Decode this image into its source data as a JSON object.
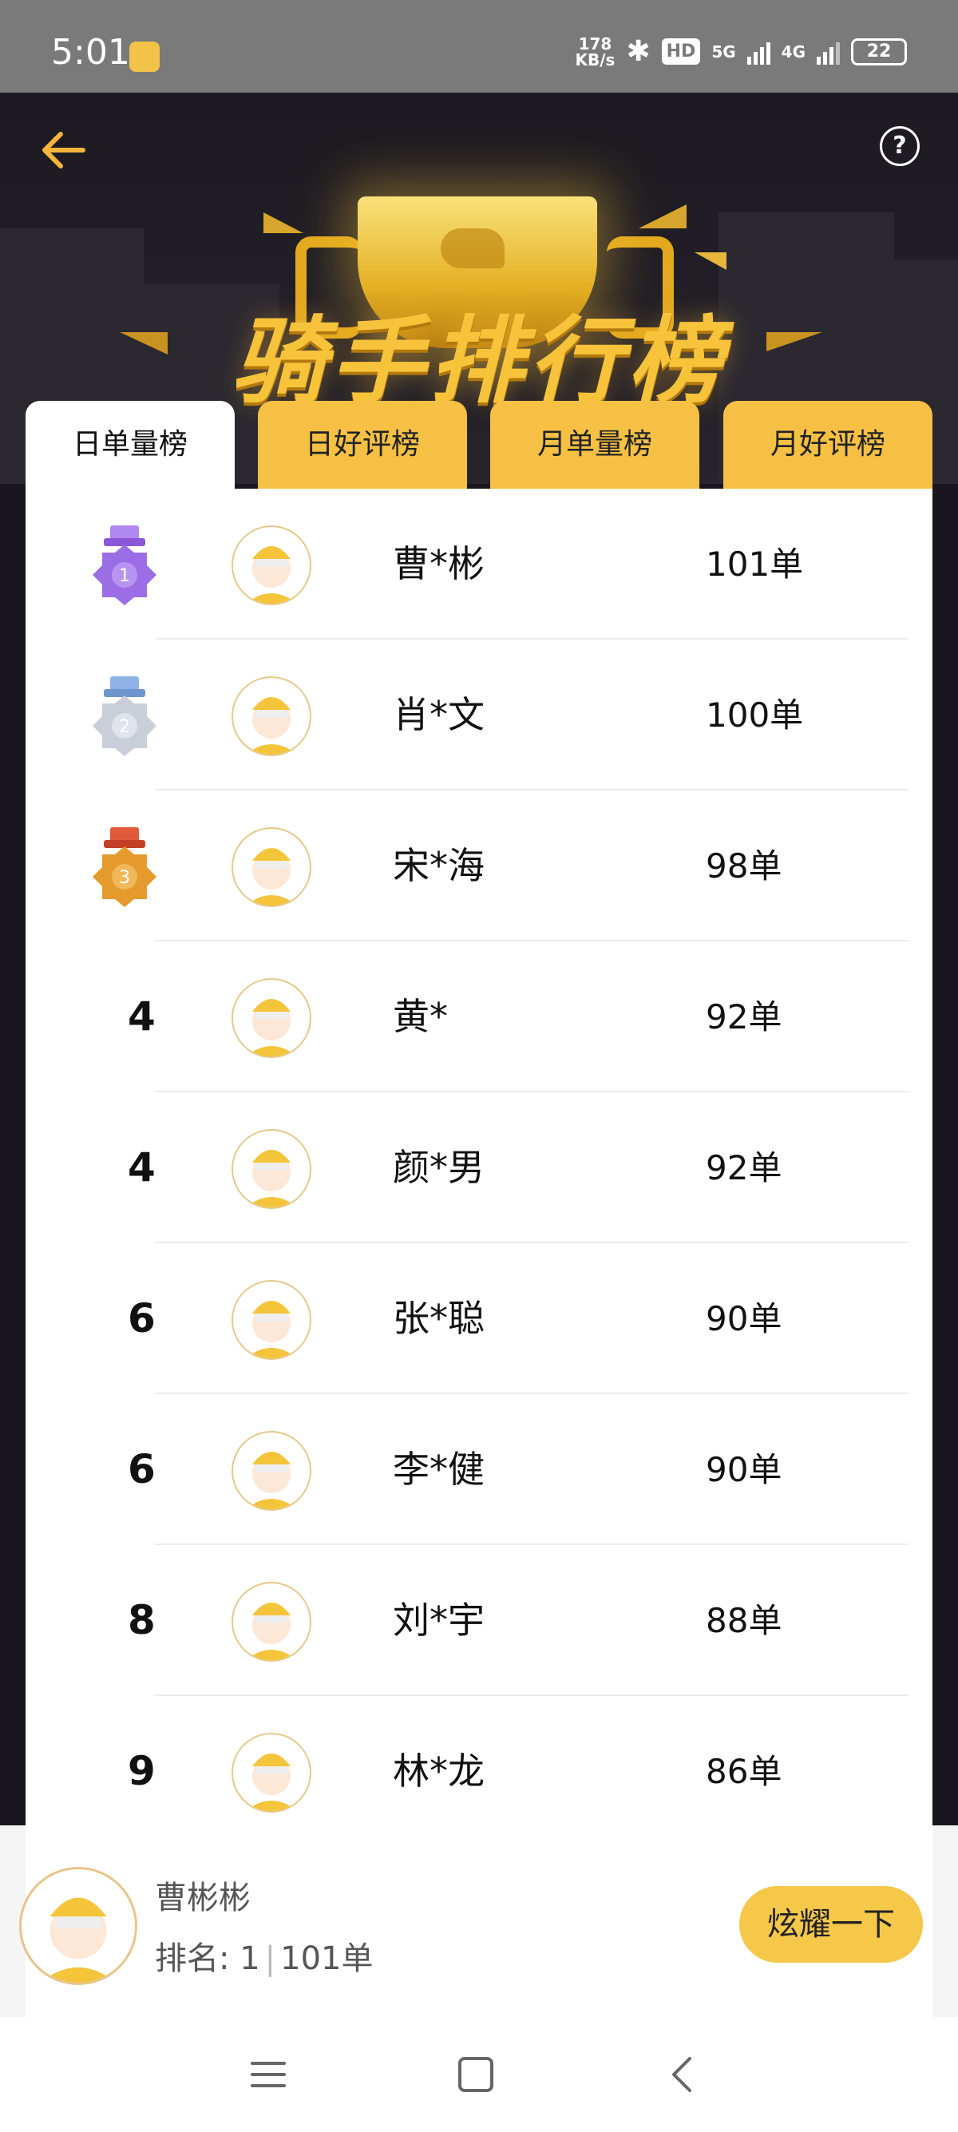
{
  "status_bar": {
    "time": "5:01",
    "net_speed_top": "178",
    "net_speed_bottom": "KB/s",
    "hd": "HD",
    "net_5g": "5G",
    "net_4g": "4G",
    "battery": "22"
  },
  "header": {
    "title": "骑手排行榜"
  },
  "tabs": [
    {
      "label": "日单量榜",
      "active": true
    },
    {
      "label": "日好评榜",
      "active": false
    },
    {
      "label": "月单量榜",
      "active": false
    },
    {
      "label": "月好评榜",
      "active": false
    }
  ],
  "ranking": [
    {
      "rank": "1",
      "name": "曹*彬",
      "orders": "101单",
      "medal": "purple"
    },
    {
      "rank": "2",
      "name": "肖*文",
      "orders": "100单",
      "medal": "silver"
    },
    {
      "rank": "3",
      "name": "宋*海",
      "orders": "98单",
      "medal": "bronze"
    },
    {
      "rank": "4",
      "name": "黄*",
      "orders": "92单"
    },
    {
      "rank": "4",
      "name": "颜*男",
      "orders": "92单"
    },
    {
      "rank": "6",
      "name": "张*聪",
      "orders": "90单"
    },
    {
      "rank": "6",
      "name": "李*健",
      "orders": "90单"
    },
    {
      "rank": "8",
      "name": "刘*宇",
      "orders": "88单"
    },
    {
      "rank": "9",
      "name": "林*龙",
      "orders": "86单"
    }
  ],
  "my_rank": {
    "name": "曹彬彬",
    "rank_label": "排名: 1",
    "separator": "|",
    "orders": "101单",
    "button_label": "炫耀一下"
  },
  "colors": {
    "accent": "#f5c044",
    "medal_purple": "#9b6ee6",
    "medal_silver": "#c9ced8",
    "medal_bronze": "#e59a2c"
  }
}
